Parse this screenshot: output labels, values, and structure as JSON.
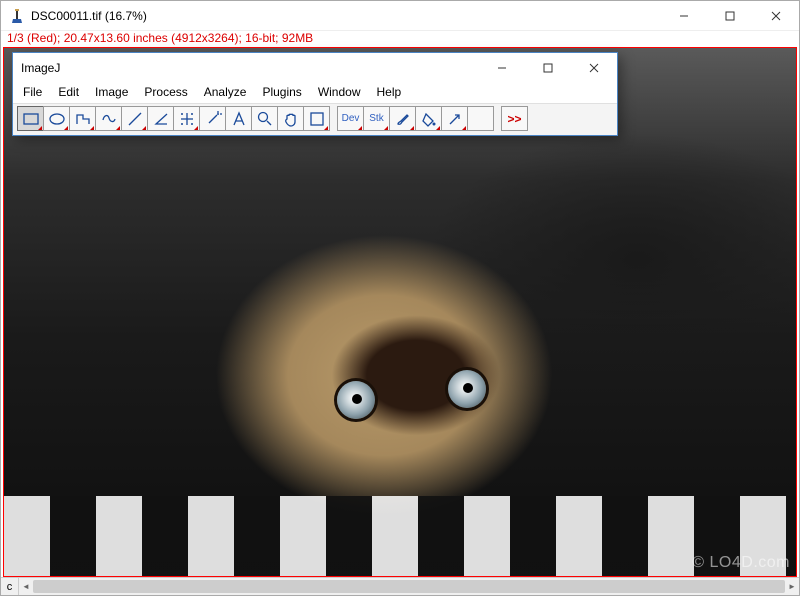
{
  "outer_window": {
    "title": "DSC00011.tif (16.7%)",
    "info_line": "1/3 (Red); 20.47x13.60 inches (4912x3264); 16-bit; 92MB",
    "channel_letter": "c"
  },
  "ij_window": {
    "title": "ImageJ",
    "menu": {
      "file": "File",
      "edit": "Edit",
      "image": "Image",
      "process": "Process",
      "analyze": "Analyze",
      "plugins": "Plugins",
      "window": "Window",
      "help": "Help"
    },
    "tools": {
      "dev": "Dev",
      "stk": "Stk",
      "more": ">>"
    }
  },
  "watermark": "© LO4D.com"
}
